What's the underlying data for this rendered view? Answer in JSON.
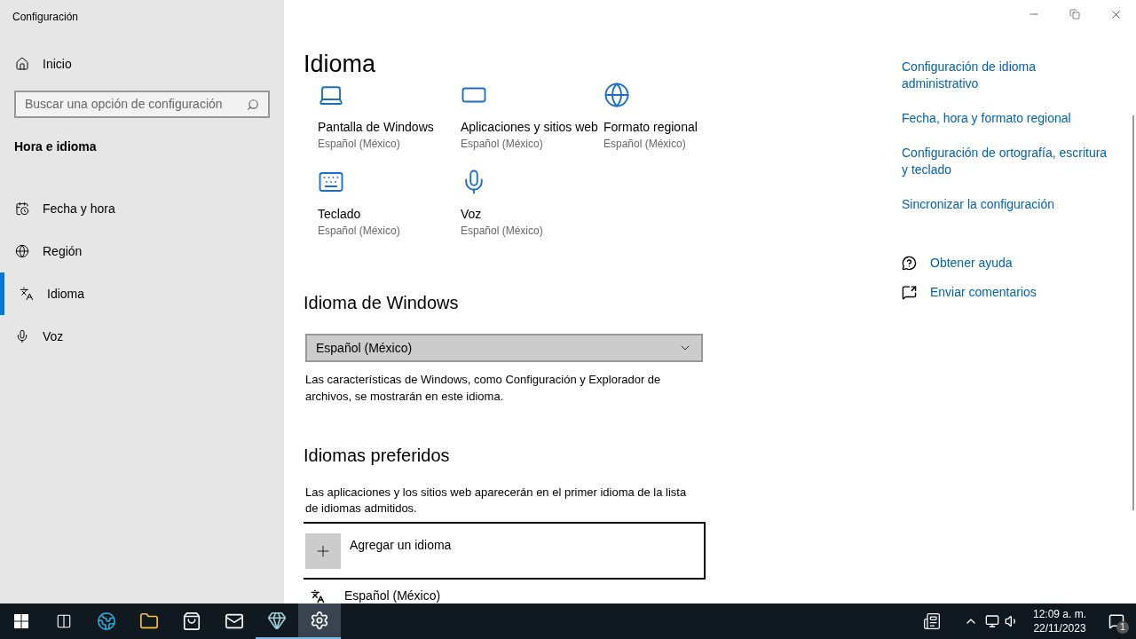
{
  "window": {
    "title": "Configuración"
  },
  "sidebar": {
    "home": "Inicio",
    "search": {
      "placeholder": "Buscar una opción de configuración"
    },
    "section": "Hora e idioma",
    "items": [
      {
        "label": "Fecha y hora",
        "selected": false
      },
      {
        "label": "Región",
        "selected": false
      },
      {
        "label": "Idioma",
        "selected": true
      },
      {
        "label": "Voz",
        "selected": false
      }
    ]
  },
  "page": {
    "title": "Idioma",
    "tiles": [
      {
        "title": "Pantalla de Windows",
        "subtitle": "Español (México)"
      },
      {
        "title": "Aplicaciones y sitios web",
        "subtitle": "Español (México)"
      },
      {
        "title": "Formato regional",
        "subtitle": "Español (México)"
      },
      {
        "title": "Teclado",
        "subtitle": "Español (México)"
      },
      {
        "title": "Voz",
        "subtitle": "Español (México)"
      }
    ],
    "windows_language": {
      "heading": "Idioma de Windows",
      "dropdown": {
        "value": "Español (México)"
      },
      "description": "Las características de Windows, como Configuración y Explorador de archivos, se mostrarán en este idioma."
    },
    "preferred": {
      "heading": "Idiomas preferidos",
      "description": "Las aplicaciones y los sitios web aparecerán en el primer idioma de la lista de idiomas admitidos.",
      "add_button": "Agregar un idioma",
      "languages": [
        {
          "name": "Español (México)"
        }
      ]
    }
  },
  "related": {
    "links": [
      "Configuración de idioma administrativo",
      "Fecha, hora y formato regional",
      "Configuración de ortografía, escritura y teclado",
      "Sincronizar la configuración"
    ],
    "help": [
      "Obtener ayuda",
      "Enviar comentarios"
    ]
  },
  "taskbar": {
    "apps": [
      {
        "running": false,
        "selected": false
      },
      {
        "running": false,
        "selected": false
      },
      {
        "running": false,
        "selected": false
      },
      {
        "running": false,
        "selected": false
      },
      {
        "running": true,
        "selected": false
      },
      {
        "running": true,
        "selected": true
      }
    ],
    "clock": {
      "time": "12:09 a. m.",
      "date": "22/11/2023"
    },
    "notifications": {
      "count": "1"
    }
  }
}
